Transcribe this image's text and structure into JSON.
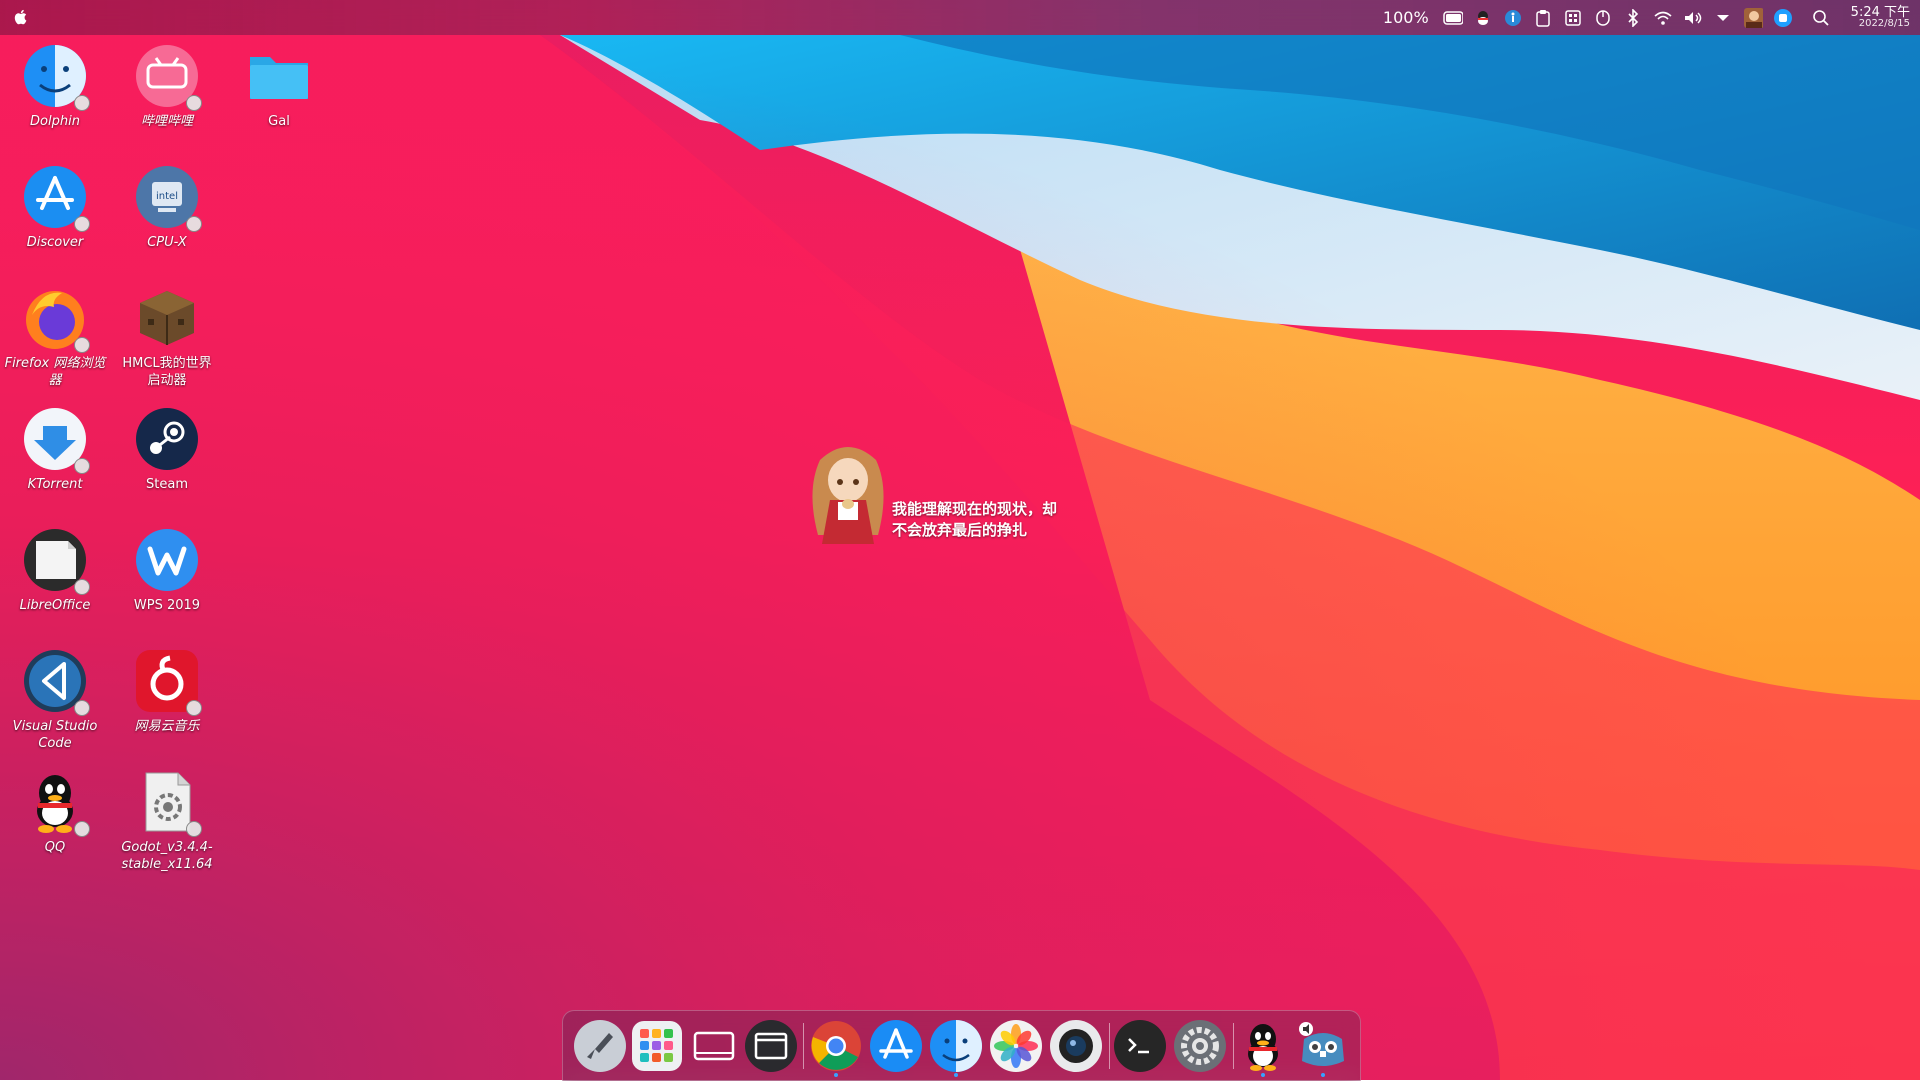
{
  "topbar": {
    "battery_percent": "100%",
    "time": "5:24 下午",
    "date": "2022/8/15",
    "icons": [
      "apple-logo",
      "battery-icon",
      "qq-tray-icon",
      "accessibility-icon",
      "clipboard-icon",
      "calculator-icon",
      "mouse-icon",
      "bluetooth-icon",
      "wifi-icon",
      "volume-icon",
      "dropdown-arrow-icon",
      "user-avatar-icon",
      "app-tray-icon",
      "search-icon"
    ]
  },
  "desktop_icons": [
    {
      "label": "Dolphin",
      "icon": "dolphin-file-manager-icon"
    },
    {
      "label": "哔哩哔哩",
      "icon": "bilibili-icon"
    },
    {
      "label": "Gal",
      "icon": "folder-icon"
    },
    {
      "label": "Discover",
      "icon": "discover-store-icon"
    },
    {
      "label": "CPU-X",
      "icon": "cpu-x-icon"
    },
    {
      "label": "Firefox 网络浏览器",
      "icon": "firefox-icon"
    },
    {
      "label": "HMCL我的世界启动器",
      "icon": "minecraft-launcher-icon"
    },
    {
      "label": "KTorrent",
      "icon": "ktorrent-icon"
    },
    {
      "label": "Steam",
      "icon": "steam-icon"
    },
    {
      "label": "LibreOffice",
      "icon": "libreoffice-icon"
    },
    {
      "label": "WPS 2019",
      "icon": "wps-icon"
    },
    {
      "label": "Visual Studio Code",
      "icon": "vscode-icon"
    },
    {
      "label": "网易云音乐",
      "icon": "netease-music-icon"
    },
    {
      "label": "QQ",
      "icon": "qq-icon"
    },
    {
      "label": "Godot_v3.4.4-stable_x11.64",
      "icon": "godot-file-icon"
    }
  ],
  "widget": {
    "line1": "我能理解现在的现状，却",
    "line2": "不会放弃最后的挣扎"
  },
  "dock": {
    "items": [
      "launchpad-rocket-icon",
      "app-grid-icon",
      "show-desktop-icon",
      "window-switcher-icon",
      "chrome-icon",
      "app-store-icon",
      "finder-icon",
      "photos-icon",
      "camera-icon",
      "terminal-icon",
      "system-settings-icon",
      "qq-dock-icon",
      "godot-dock-icon"
    ]
  },
  "colors": {
    "wall_magenta": "#ff1f5a",
    "wall_blue": "#0ea2e6",
    "wall_orange": "#ffa51f",
    "accent_blue": "#38a2ff"
  }
}
